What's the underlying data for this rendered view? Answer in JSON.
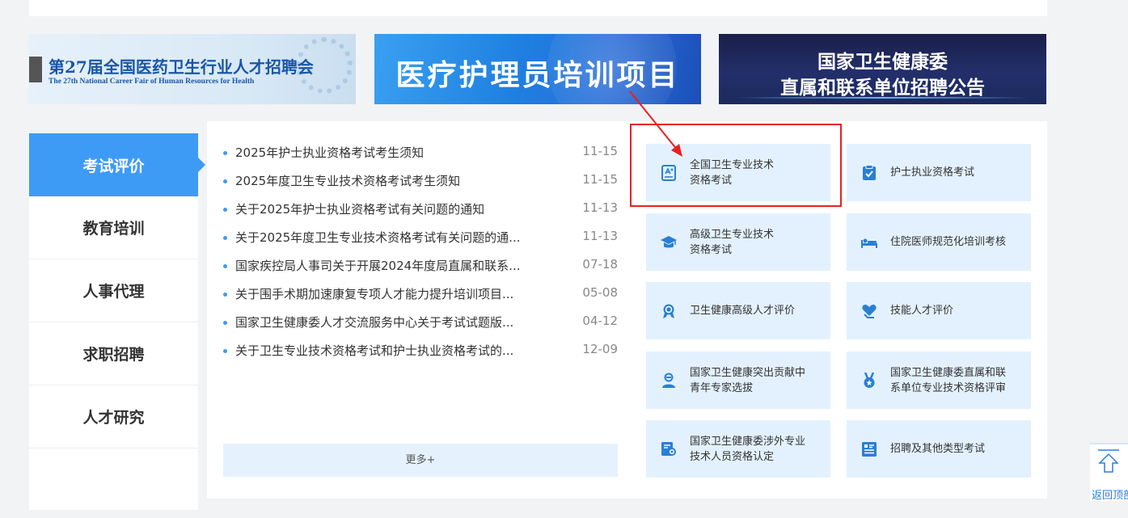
{
  "banners": {
    "fair": {
      "title": "第27届全国医药卫生行业人才招聘会",
      "subtitle": "The 27th National Career Fair of Human Resources for Health"
    },
    "nursing": {
      "title": "医疗护理员培训项目"
    },
    "notice": {
      "line1": "国家卫生健康委",
      "line2": "直属和联系单位招聘公告"
    }
  },
  "tabs": [
    {
      "label": "考试评价",
      "active": true
    },
    {
      "label": "教育培训",
      "active": false
    },
    {
      "label": "人事代理",
      "active": false
    },
    {
      "label": "求职招聘",
      "active": false
    },
    {
      "label": "人才研究",
      "active": false
    }
  ],
  "news": [
    {
      "title": "2025年护士执业资格考试考生须知",
      "date": "11-15"
    },
    {
      "title": "2025年度卫生专业技术资格考试考生须知",
      "date": "11-15"
    },
    {
      "title": "关于2025年护士执业资格考试有关问题的通知",
      "date": "11-13"
    },
    {
      "title": "关于2025年度卫生专业技术资格考试有关问题的通...",
      "date": "11-13"
    },
    {
      "title": "国家疾控局人事司关于开展2024年度局直属和联系...",
      "date": "07-18"
    },
    {
      "title": "关于围手术期加速康复专项人才能力提升培训项目...",
      "date": "05-08"
    },
    {
      "title": "国家卫生健康委人才交流服务中心关于考试试题版...",
      "date": "04-12"
    },
    {
      "title": "关于卫生专业技术资格考试和护士执业资格考试的...",
      "date": "12-09"
    }
  ],
  "more_label": "更多+",
  "services": [
    {
      "label": "全国卫生专业技术\n资格考试",
      "icon": "certificate-icon"
    },
    {
      "label": "护士执业资格考试",
      "icon": "clipboard-check-icon"
    },
    {
      "label": "高级卫生专业技术\n资格考试",
      "icon": "graduation-cap-icon"
    },
    {
      "label": "住院医师规范化培训考核",
      "icon": "hospital-bed-icon"
    },
    {
      "label": "卫生健康高级人才评价",
      "icon": "award-ribbon-icon"
    },
    {
      "label": "技能人才评价",
      "icon": "heart-hand-icon"
    },
    {
      "label": "国家卫生健康突出贡献中\n青年专家选拔",
      "icon": "expert-user-icon"
    },
    {
      "label": "国家卫生健康委直属和联\n系单位专业技术资格评审",
      "icon": "medal-icon"
    },
    {
      "label": "国家卫生健康委涉外专业\n技术人员资格认定",
      "icon": "document-person-icon"
    },
    {
      "label": "招聘及其他类型考试",
      "icon": "list-form-icon"
    }
  ],
  "back_to_top": "返回顶部",
  "colors": {
    "accent": "#3d9bf6",
    "card_bg": "#e3f1fe",
    "highlight": "#e8211f"
  }
}
